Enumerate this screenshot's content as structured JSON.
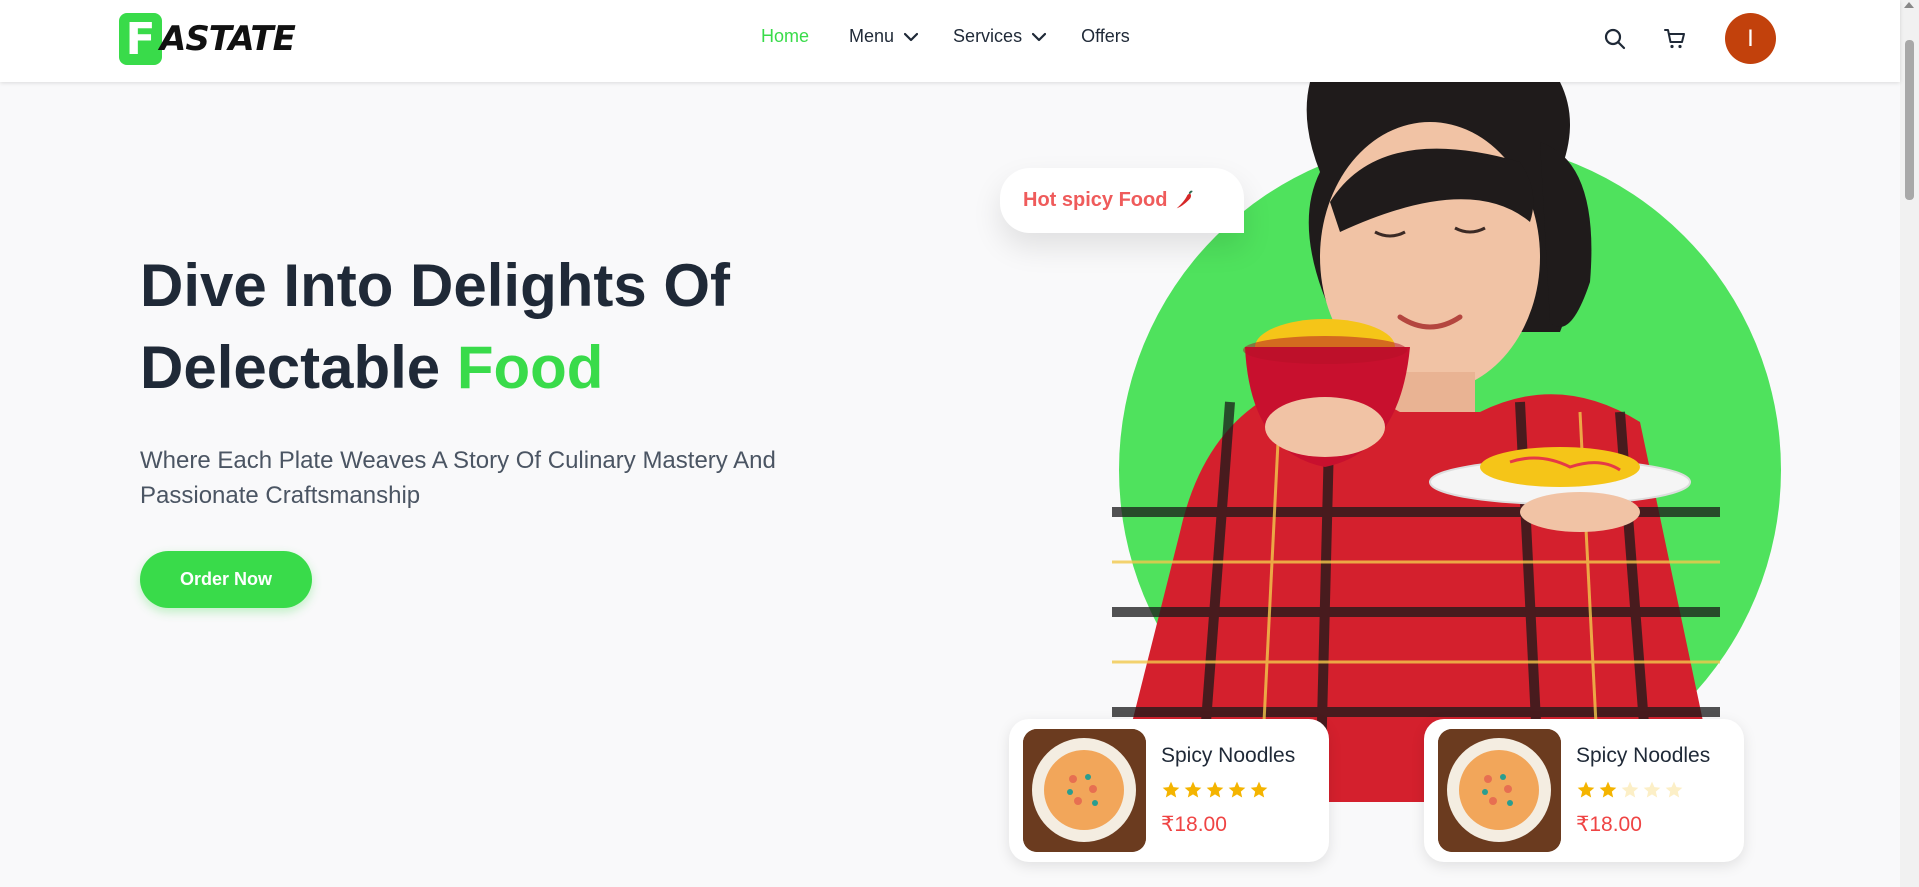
{
  "brand": {
    "logo_letter": "F",
    "logo_text": "ASTATE",
    "accent": "#39db4a"
  },
  "nav": {
    "home": "Home",
    "menu": "Menu",
    "services": "Services",
    "offers": "Offers"
  },
  "header_icons": [
    "search-icon",
    "cart-icon"
  ],
  "user": {
    "avatar_initial": "I",
    "avatar_color": "#c2410c"
  },
  "hero": {
    "title_line1": "Dive Into Delights Of",
    "title_line2_prefix": "Delectable ",
    "title_line2_highlight": "Food",
    "subtitle": "Where Each Plate Weaves A Story Of Culinary Mastery And Passionate Craftsmanship",
    "cta": "Order Now"
  },
  "bubble": {
    "text": "Hot spicy Food",
    "icon": "chili-icon"
  },
  "products": [
    {
      "name": "Spicy Noodles",
      "rating": 5,
      "max_rating": 5,
      "price": "₹18.00"
    },
    {
      "name": "Spicy Noodles",
      "rating": 2,
      "max_rating": 5,
      "price": "₹18.00"
    }
  ]
}
